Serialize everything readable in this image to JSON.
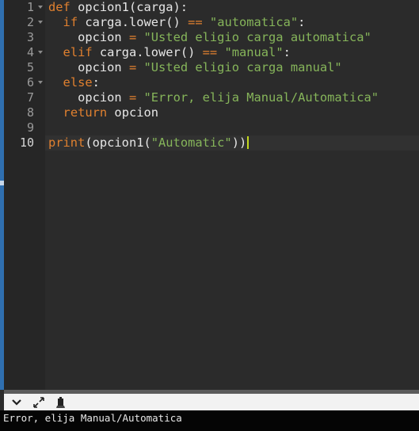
{
  "editor": {
    "gutter": [
      {
        "n": "1",
        "fold": true
      },
      {
        "n": "2",
        "fold": true
      },
      {
        "n": "3",
        "fold": false
      },
      {
        "n": "4",
        "fold": true
      },
      {
        "n": "5",
        "fold": false
      },
      {
        "n": "6",
        "fold": true
      },
      {
        "n": "7",
        "fold": false
      },
      {
        "n": "8",
        "fold": false
      },
      {
        "n": "9",
        "fold": false
      },
      {
        "n": "10",
        "fold": false
      }
    ],
    "lines": [
      [
        [
          "kw",
          "def"
        ],
        [
          "txt",
          " opcion1(carga):"
        ]
      ],
      [
        [
          "txt",
          "  "
        ],
        [
          "kw",
          "if"
        ],
        [
          "txt",
          " carga.lower() "
        ],
        [
          "op",
          "=="
        ],
        [
          "txt",
          " "
        ],
        [
          "str",
          "\"automatica\""
        ],
        [
          "txt",
          ":"
        ]
      ],
      [
        [
          "txt",
          "    opcion "
        ],
        [
          "op",
          "="
        ],
        [
          "txt",
          " "
        ],
        [
          "str",
          "\"Usted eligio carga automatica\""
        ]
      ],
      [
        [
          "txt",
          "  "
        ],
        [
          "kw",
          "elif"
        ],
        [
          "txt",
          " carga.lower() "
        ],
        [
          "op",
          "=="
        ],
        [
          "txt",
          " "
        ],
        [
          "str",
          "\"manual\""
        ],
        [
          "txt",
          ":"
        ]
      ],
      [
        [
          "txt",
          "    opcion "
        ],
        [
          "op",
          "="
        ],
        [
          "txt",
          " "
        ],
        [
          "str",
          "\"Usted eligio carga manual\""
        ]
      ],
      [
        [
          "txt",
          "  "
        ],
        [
          "kw",
          "else"
        ],
        [
          "txt",
          ":"
        ]
      ],
      [
        [
          "txt",
          "    opcion "
        ],
        [
          "op",
          "="
        ],
        [
          "txt",
          " "
        ],
        [
          "str",
          "\"Error, elija Manual/Automatica\""
        ]
      ],
      [
        [
          "txt",
          "  "
        ],
        [
          "kw",
          "return"
        ],
        [
          "txt",
          " opcion"
        ]
      ],
      [],
      [
        [
          "fn",
          "print"
        ],
        [
          "txt",
          "(opcion1("
        ],
        [
          "str",
          "\"Automatic\""
        ],
        [
          "txt",
          "))"
        ]
      ]
    ],
    "active_line": 10
  },
  "toolbar": {
    "icons": [
      "chevron-down-icon",
      "expand-icon",
      "clear-console-icon"
    ]
  },
  "console": {
    "output": "Error, elija Manual/Automatica"
  }
}
